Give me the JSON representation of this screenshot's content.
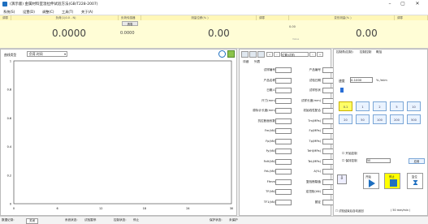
{
  "title": "(演示版) 金属材料室温拉伸试验方法(GB/T228-2007)",
  "menu": [
    "系统(S)",
    "设置(D)",
    "调整(C)",
    "工具(T)",
    "关于(A)"
  ],
  "readouts": {
    "load": {
      "header": "负荷(1)0.0 - N)",
      "badge_left": "调零",
      "badge_right": "负荷传感器",
      "value": "0.0000",
      "sub": "0.0000",
      "subbtn": "清零"
    },
    "ext": {
      "header": "测量位移(% )",
      "badge": "调零",
      "value": "0.00",
      "sub": ""
    },
    "disp": {
      "header": "变形测量(% )",
      "badge": "调零",
      "value": "0.00",
      "sub": "0.00",
      "subsub": "Value"
    }
  },
  "curve": {
    "type_label": "曲线类型",
    "type_value": "负荷-时间",
    "ylabels": [
      "1",
      "0.8",
      "0.6",
      "0.4",
      "0.2",
      "0"
    ],
    "xlabels": [
      "0",
      "6",
      "12",
      "18",
      "24",
      "30"
    ]
  },
  "chart_data": {
    "type": "line",
    "xlim": [
      0,
      30
    ],
    "ylim": [
      0,
      1
    ],
    "series": [],
    "xlabel": "",
    "ylabel": ""
  },
  "params": {
    "toolbar_combo": "位置(试样)",
    "tabs": [
      "详细",
      "列表"
    ],
    "rows": [
      [
        "试样编号",
        "产品编号"
      ],
      [
        "产品名称",
        "试验日期"
      ],
      [
        "日期人",
        "试样形状"
      ],
      [
        "尺寸(mm)",
        "试样长度(mm)"
      ],
      [
        "原标计长度(mm)",
        "初始线性配合"
      ],
      [
        "抗拉断面系数",
        "Tm(MPa)"
      ],
      [
        "Fm(kN)",
        "Fp(MPa)"
      ],
      [
        "Fp(kN)",
        "Tp(MPa)"
      ],
      [
        "Fy(kN)",
        "TeH(MPa)"
      ],
      [
        "FeH(kN)",
        "TeL(MPa)"
      ],
      [
        "FeL(kN)",
        "A(%)"
      ],
      [
        "Ffmm",
        "复验断裂值"
      ],
      [
        "TF(kN)",
        "定扭矩(kN)"
      ],
      [
        "TF1(kN)",
        "额定"
      ]
    ]
  },
  "ctrl": {
    "tabs": [
      "控制角(控制)",
      "控制控制",
      "概括"
    ],
    "speed_label": "速度",
    "speed_value": "0.1000",
    "speed_unit": "%  /mim",
    "speed_buttons": [
      "0.1",
      "1",
      "2",
      "5",
      "10",
      "20",
      "50",
      "100",
      "200",
      "500"
    ],
    "check1": "开始控制",
    "check2": "保持控制",
    "check2_val": "50",
    "confirm": "应用",
    "start": "开始",
    "stop": "停止",
    "reset": "复位",
    "bottom_check": "试验结束后自动返回",
    "bottom_val": "( 50 mm/min )"
  },
  "status": {
    "label1": "数据记录:",
    "box1": "关闭",
    "label2": "系统状态:",
    "val2": "试验暂停",
    "label3": "控制状态:",
    "val3": "停止",
    "label4": "保护状态:",
    "val4": "未保护"
  }
}
